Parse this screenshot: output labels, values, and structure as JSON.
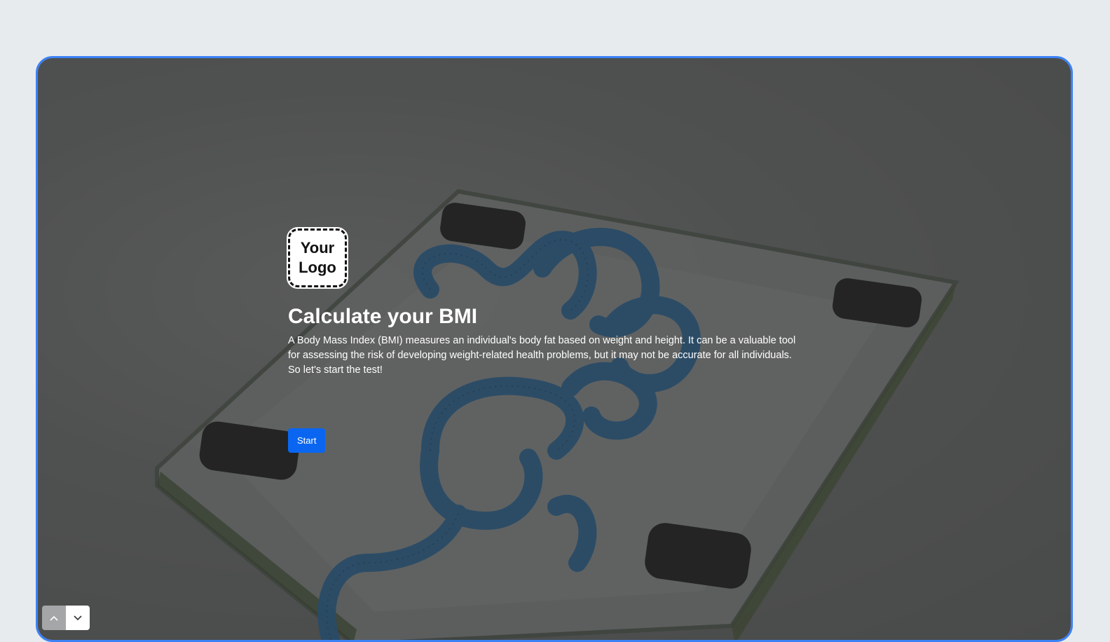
{
  "logo": {
    "line1": "Your",
    "line2": "Logo"
  },
  "hero": {
    "title": "Calculate your BMI",
    "description": "A Body Mass Index (BMI) measures an individual's body fat based on weight and height. It can be a valuable tool for assessing the risk of developing weight-related health problems, but it may not be accurate for all individuals. So let's start the test!",
    "start_label": "Start"
  },
  "background": {
    "subject": "glass bathroom scale with blue measuring tape"
  },
  "navigation": {
    "up_icon": "chevron-up-icon",
    "down_icon": "chevron-down-icon"
  },
  "colors": {
    "frame_border": "#3b82f6",
    "start_button": "#0a66f0",
    "page_background": "#e8ebee"
  }
}
